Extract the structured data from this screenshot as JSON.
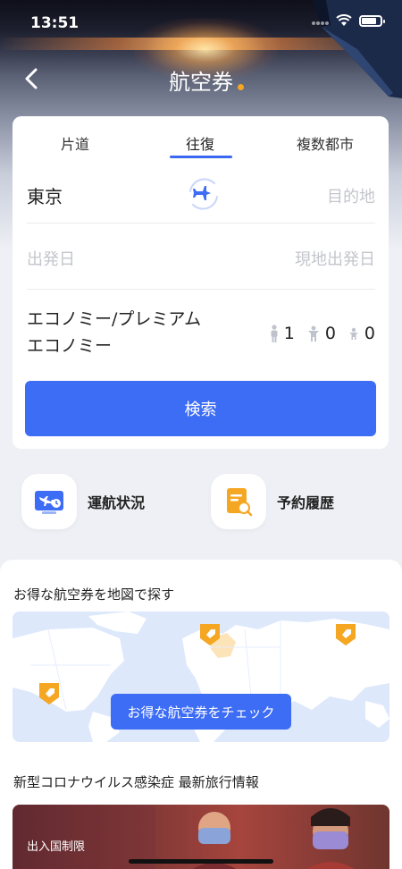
{
  "status_bar": {
    "time": "13:51"
  },
  "header": {
    "title": "航空券"
  },
  "tabs": [
    {
      "label": "片道"
    },
    {
      "label": "往復"
    },
    {
      "label": "複数都市"
    }
  ],
  "route": {
    "origin": "東京",
    "destination_placeholder": "目的地"
  },
  "dates": {
    "depart_placeholder": "出発日",
    "return_placeholder": "現地出発日"
  },
  "cabin": {
    "line1": "エコノミー/プレミアム",
    "line2": "エコノミー"
  },
  "passengers": {
    "adults": "1",
    "children": "0",
    "infants": "0"
  },
  "search_label": "検索",
  "quick_links": [
    {
      "label": "運航状況",
      "icon": "flight-status-icon"
    },
    {
      "label": "予約履歴",
      "icon": "booking-history-icon"
    }
  ],
  "map_section": {
    "title": "お得な航空券を地図で探す",
    "button": "お得な航空券をチェック"
  },
  "covid_section": {
    "title": "新型コロナウイルス感染症 最新旅行情報",
    "banner_label": "出入国制限"
  },
  "colors": {
    "accent": "#3d6cf5",
    "pin": "#f5a623"
  }
}
